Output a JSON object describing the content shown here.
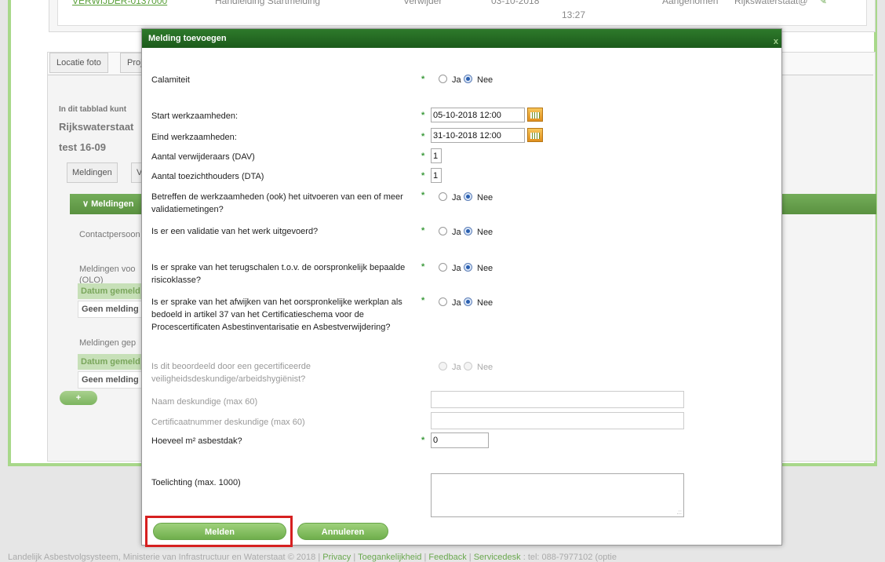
{
  "background": {
    "top_row": {
      "link": "VERWIJDER-0137000",
      "description": "Handleiding Startmelding",
      "type": "Verwijder",
      "date": "03-10-2018",
      "time": "13:27",
      "status": "Aangenomen",
      "organisation": "Rijkswaterstaat@"
    },
    "tabs": [
      "Locatie foto",
      "Proj"
    ],
    "info_text": "In dit tabblad kunt",
    "org_name": "Rijkswaterstaat",
    "project_name": "test 16-09",
    "subtabs": [
      "Meldingen",
      "Ver"
    ],
    "section_header": "Meldingen",
    "contact_label": "Contactpersoon",
    "meldingen_voor": "Meldingen voo",
    "olo": "(OLO)",
    "grid_header_1": "Datum gemeld",
    "grid_row_1": "Geen melding",
    "meldingen_gep": "Meldingen gep",
    "grid_header_2": "Datum gemeld",
    "grid_row_2": "Geen melding",
    "add_button": "+"
  },
  "footer": {
    "text": "Landelijk Asbestvolgsysteem, Ministerie van Infrastructuur en Waterstaat © 2018 | ",
    "links": [
      "Privacy",
      "Toegankelijkheid",
      "Feedback",
      "Servicedesk"
    ],
    "tail": ": tel: 088-7977102 (optie"
  },
  "modal": {
    "title": "Melding toevoegen",
    "close": "x",
    "fields": {
      "calamiteit": {
        "label": "Calamiteit",
        "yes": "Ja",
        "no": "Nee",
        "selected": "Nee"
      },
      "start": {
        "label": "Start werkzaamheden:",
        "value": "05-10-2018 12:00"
      },
      "eind": {
        "label": "Eind werkzaamheden:",
        "value": "31-10-2018 12:00"
      },
      "dav": {
        "label": "Aantal verwijderaars (DAV)",
        "value": "1"
      },
      "dta": {
        "label": "Aantal toezichthouders (DTA)",
        "value": "1"
      },
      "validatiemetingen": {
        "label": "Betreffen de werkzaamheden (ook) het uitvoeren van een of meer validatiemetingen?",
        "yes": "Ja",
        "no": "Nee",
        "selected": "Nee"
      },
      "validatie": {
        "label": "Is er een validatie van het werk uitgevoerd?",
        "yes": "Ja",
        "no": "Nee",
        "selected": "Nee"
      },
      "terugschalen": {
        "label": "Is er sprake van het terugschalen t.o.v. de oorspronkelijk bepaalde risicoklasse?",
        "yes": "Ja",
        "no": "Nee",
        "selected": "Nee"
      },
      "afwijken": {
        "label": "Is er sprake van het afwijken van het oorspronkelijke werkplan als bedoeld in artikel 37 van het Certificatieschema voor de Procescertificaten Asbestinventarisatie en Asbestverwijdering?",
        "yes": "Ja",
        "no": "Nee",
        "selected": "Nee"
      },
      "beoordeeld": {
        "label": "Is dit beoordeeld door een gecertificeerde veiligheidsdeskundige/arbeidshygiënist?",
        "yes": "Ja",
        "no": "Nee"
      },
      "naam_deskundige": {
        "label": "Naam deskundige (max 60)",
        "value": ""
      },
      "certificaat_deskundige": {
        "label": "Certificaatnummer deskundige (max 60)",
        "value": ""
      },
      "asbestdak": {
        "label": "Hoeveel m² asbestdak?",
        "value": "0"
      },
      "toelichting": {
        "label": "Toelichting (max. 1000)",
        "value": ""
      }
    },
    "required_marker": "*",
    "buttons": {
      "submit": "Melden",
      "cancel": "Annuleren"
    }
  }
}
